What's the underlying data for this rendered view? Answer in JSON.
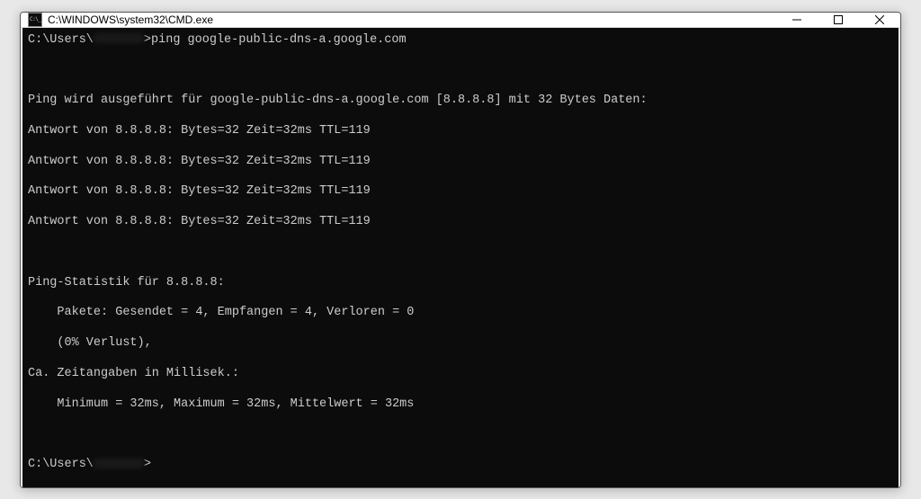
{
  "window": {
    "title": "C:\\WINDOWS\\system32\\CMD.exe"
  },
  "prompt1_pre": "C:\\Users\\",
  "prompt1_post": ">",
  "command1": "ping google-public-dns-a.google.com",
  "output": {
    "line1": "Ping wird ausgeführt für google-public-dns-a.google.com [8.8.8.8] mit 32 Bytes Daten:",
    "reply1": "Antwort von 8.8.8.8: Bytes=32 Zeit=32ms TTL=119",
    "reply2": "Antwort von 8.8.8.8: Bytes=32 Zeit=32ms TTL=119",
    "reply3": "Antwort von 8.8.8.8: Bytes=32 Zeit=32ms TTL=119",
    "reply4": "Antwort von 8.8.8.8: Bytes=32 Zeit=32ms TTL=119",
    "stats_header": "Ping-Statistik für 8.8.8.8:",
    "packets": "    Pakete: Gesendet = 4, Empfangen = 4, Verloren = 0",
    "loss": "    (0% Verlust),",
    "times_hdr": "Ca. Zeitangaben in Millisek.:",
    "times": "    Minimum = 32ms, Maximum = 32ms, Mittelwert = 32ms"
  },
  "prompt2_pre": "C:\\Users\\",
  "prompt2_post": ">"
}
